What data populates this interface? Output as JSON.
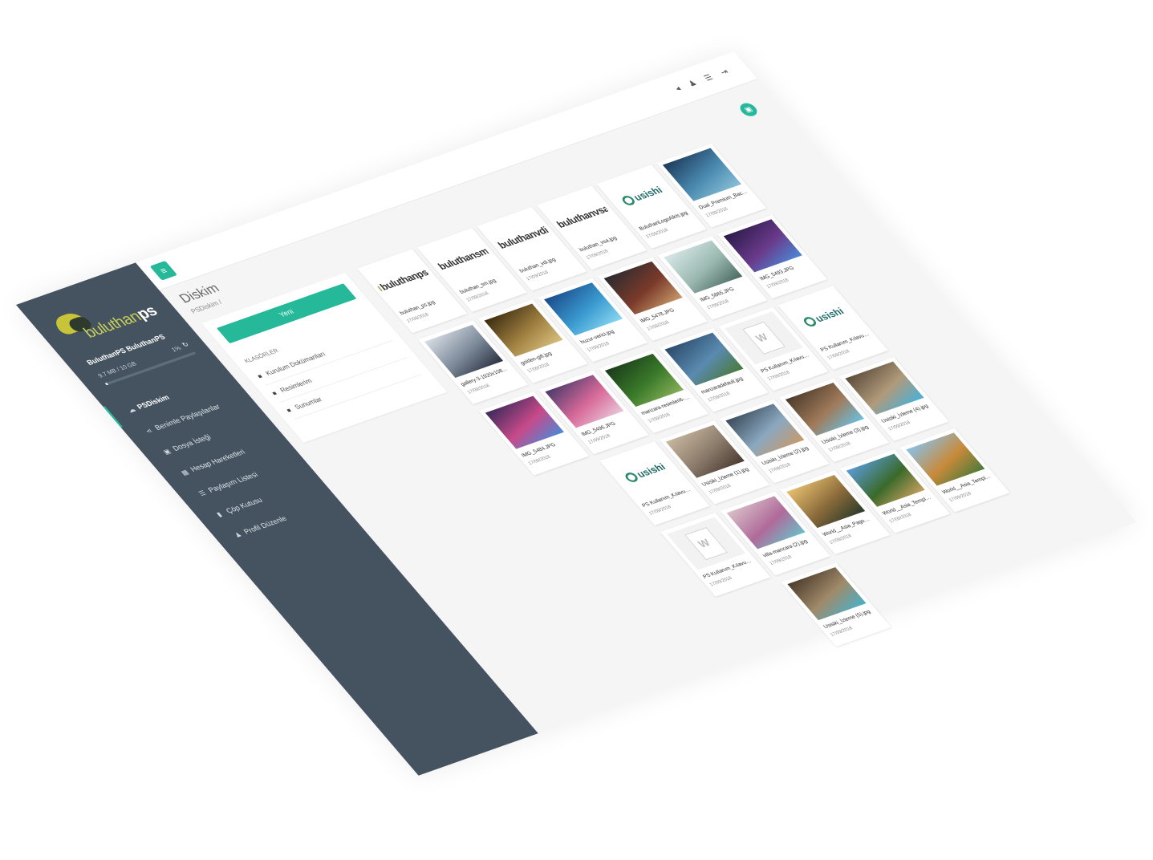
{
  "sidebar": {
    "logo_text_light": "buluthan",
    "logo_text_bold": "ps",
    "user_name": "BuluthanPS BuluthanPS",
    "quota_used": "9.7 MB / 10 GB",
    "quota_percent": "1%",
    "quota_fraction": 0.01,
    "refresh_icon": "↻",
    "nav": [
      {
        "label": "PSDiskim",
        "icon": "cloud-icon",
        "glyph": "☁"
      },
      {
        "label": "Benimle Paylaşılanlar",
        "icon": "share-icon",
        "glyph": "⋖"
      },
      {
        "label": "Dosya İsteği",
        "icon": "file-request-icon",
        "glyph": "▣"
      },
      {
        "label": "Hesap Hareketleri",
        "icon": "calendar-icon",
        "glyph": "▦"
      },
      {
        "label": "Paylaşım Listesi",
        "icon": "list-icon",
        "glyph": "☰"
      },
      {
        "label": "Çöp Kutusu",
        "icon": "trash-icon",
        "glyph": "▮"
      },
      {
        "label": "Profil Düzenle",
        "icon": "user-icon",
        "glyph": "♟"
      }
    ]
  },
  "header": {
    "menu_glyph": "≡",
    "icons": [
      {
        "name": "notification-icon",
        "glyph": "◂"
      },
      {
        "name": "user-icon",
        "glyph": "♟"
      },
      {
        "name": "settings-icon",
        "glyph": "☰"
      },
      {
        "name": "logout-icon",
        "glyph": "⇥"
      }
    ],
    "fab_glyph": "▣"
  },
  "page": {
    "title": "Diskim",
    "breadcrumb": "PSDiskim /"
  },
  "panel": {
    "new_button": "Yeni",
    "folders_title": "KLASÖRLER",
    "folders": [
      "Kurulum Dokümanları",
      "Resimlerim",
      "Sunumlar"
    ]
  },
  "files": [
    {
      "name": "buluthan_ps.jpg",
      "date": "17/09/2018",
      "kind": "logo",
      "logo": "buluthanps",
      "accent": "#8aa84a"
    },
    {
      "name": "buluthan_sm.jpg",
      "date": "17/09/2018",
      "kind": "logo",
      "logo": "buluthansm",
      "accent": "#2aa0c8"
    },
    {
      "name": "buluthan_vdi.jpg",
      "date": "17/09/2018",
      "kind": "logo",
      "logo": "buluthanvdi",
      "accent": "#d8403a"
    },
    {
      "name": "buluthan_vsa.jpg",
      "date": "17/09/2018",
      "kind": "logo",
      "logo": "buluthanvsa",
      "accent": "#2aa0a0"
    },
    {
      "name": "BuluthanLogoAlkis.jpg",
      "date": "17/09/2018",
      "kind": "usishi"
    },
    {
      "name": "Dual_Premium_Backgr...",
      "date": "17/09/2018",
      "kind": "photo",
      "colors": [
        "#1d3a5a",
        "#4a8ab0",
        "#8ac0d8"
      ]
    },
    {
      "name": "",
      "date": "",
      "kind": "empty"
    },
    {
      "name": "gallery-3-1920x1080.jpg",
      "date": "17/09/2018",
      "kind": "photo",
      "colors": [
        "#d8dde4",
        "#7a8898",
        "#2a3040"
      ]
    },
    {
      "name": "golden-gift.jpg",
      "date": "17/09/2018",
      "kind": "photo",
      "colors": [
        "#3a2a10",
        "#a08040",
        "#d8c080"
      ]
    },
    {
      "name": "huzur-verici.jpg",
      "date": "17/09/2018",
      "kind": "photo",
      "colors": [
        "#1a4a8a",
        "#3a9ad0",
        "#8ad8f0"
      ]
    },
    {
      "name": "IMG_5478.JPG",
      "date": "17/09/2018",
      "kind": "photo",
      "colors": [
        "#2a2a30",
        "#7a3a2a",
        "#c89a6a"
      ]
    },
    {
      "name": "IMG_5865.JPG",
      "date": "17/09/2018",
      "kind": "photo",
      "colors": [
        "#d8e8e8",
        "#9ab8b0",
        "#4a6a60"
      ]
    },
    {
      "name": "IMG_5493.JPG",
      "date": "17/09/2018",
      "kind": "photo",
      "colors": [
        "#2a1a4a",
        "#6a3a8a",
        "#4a8ad8"
      ]
    },
    {
      "name": "",
      "date": "",
      "kind": "empty"
    },
    {
      "name": "IMG_5484.JPG",
      "date": "17/09/2018",
      "kind": "photo",
      "colors": [
        "#3a2a5a",
        "#c84a8a",
        "#4a8ad8"
      ]
    },
    {
      "name": "IMG_5496.JPG",
      "date": "17/09/2018",
      "kind": "photo",
      "colors": [
        "#4a3a6a",
        "#d86a9a",
        "#e8c8d8"
      ]
    },
    {
      "name": "manzara-resimleri6-96...",
      "date": "17/09/2018",
      "kind": "photo",
      "colors": [
        "#1a3a1a",
        "#3a7a2a",
        "#8ab05a"
      ]
    },
    {
      "name": "manzaradefault.jpg",
      "date": "17/09/2018",
      "kind": "photo",
      "colors": [
        "#2a4a6a",
        "#5a8ab0",
        "#4a7a3a"
      ]
    },
    {
      "name": "PS Kullanım_Kılavuzu_5...",
      "date": "17/09/2018",
      "kind": "word"
    },
    {
      "name": "PS Kullanım_Kılavuzu_5...",
      "date": "17/09/2018",
      "kind": "usishi"
    },
    {
      "name": "",
      "date": "",
      "kind": "empty"
    },
    {
      "name": "",
      "date": "",
      "kind": "empty"
    },
    {
      "name": "PS Kullanım_Kılavuzu_...",
      "date": "17/09/2018",
      "kind": "usishi"
    },
    {
      "name": "Usisiki_İzleme (1).jpg",
      "date": "17/09/2018",
      "kind": "photo",
      "colors": [
        "#c8b8a0",
        "#8a7a6a",
        "#4a3a30"
      ]
    },
    {
      "name": "Usisiki_İzleme (2).jpg",
      "date": "17/09/2018",
      "kind": "photo",
      "colors": [
        "#3a4a5a",
        "#8aa8c0",
        "#c89a6a"
      ]
    },
    {
      "name": "Usisiki_İzleme (3).jpg",
      "date": "17/09/2018",
      "kind": "photo",
      "colors": [
        "#4a3a2a",
        "#a07a5a",
        "#6ac0e0"
      ]
    },
    {
      "name": "Usisiki_İzleme (4).jpg",
      "date": "17/09/2018",
      "kind": "photo",
      "colors": [
        "#5a4a3a",
        "#b09a7a",
        "#4ab0d8"
      ]
    },
    {
      "name": "",
      "date": "",
      "kind": "empty"
    },
    {
      "name": "",
      "date": "",
      "kind": "empty"
    },
    {
      "name": "PS Kullanım_Kılavuzu_...",
      "date": "17/09/2018",
      "kind": "word"
    },
    {
      "name": "villa-manzara (2).jpg",
      "date": "17/09/2018",
      "kind": "photo",
      "colors": [
        "#d8c0c8",
        "#b06a9a",
        "#6ac0c8"
      ]
    },
    {
      "name": "World__Asia_Pagoda_In...",
      "date": "17/09/2018",
      "kind": "photo",
      "colors": [
        "#e8c070",
        "#8a6a3a",
        "#2a3a2a"
      ]
    },
    {
      "name": "World__Asia_Temple_o...",
      "date": "17/09/2018",
      "kind": "photo",
      "colors": [
        "#5a9ad8",
        "#3a6a2a",
        "#c8a060"
      ]
    },
    {
      "name": "World__Asia_Temple_I...",
      "date": "17/09/2018",
      "kind": "photo",
      "colors": [
        "#8ac0e8",
        "#c88a3a",
        "#4a7a3a"
      ]
    },
    {
      "name": "",
      "date": "",
      "kind": "empty"
    },
    {
      "name": "",
      "date": "",
      "kind": "empty"
    },
    {
      "name": "",
      "date": "",
      "kind": "empty"
    },
    {
      "name": "Usisiki_İzleme (5).jpg",
      "date": "17/09/2018",
      "kind": "photo",
      "colors": [
        "#4a3a2a",
        "#a08a6a",
        "#4ab0c8"
      ]
    },
    {
      "name": "",
      "date": "",
      "kind": "empty"
    },
    {
      "name": "",
      "date": "",
      "kind": "empty"
    },
    {
      "name": "",
      "date": "",
      "kind": "empty"
    },
    {
      "name": "",
      "date": "",
      "kind": "empty"
    }
  ],
  "colors": {
    "accent": "#26b999",
    "sidebar": "#44535f"
  }
}
